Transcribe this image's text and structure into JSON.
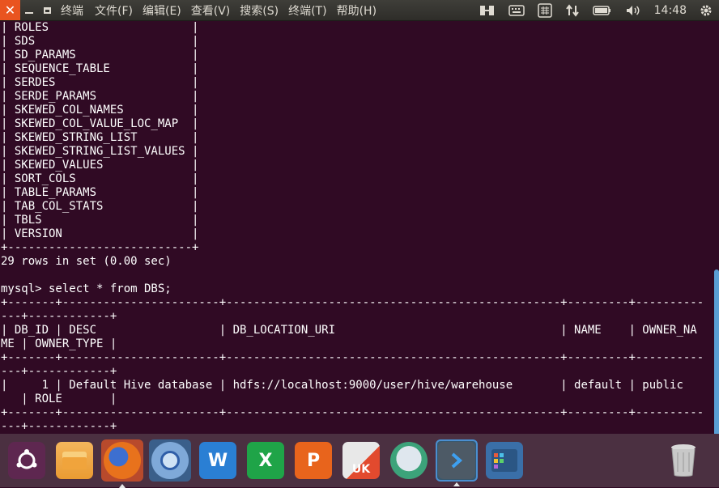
{
  "topbar": {
    "app_title": "终端",
    "menus": [
      "文件(F)",
      "编辑(E)",
      "查看(V)",
      "搜索(S)",
      "终端(T)",
      "帮助(H)"
    ],
    "clock": "14:48",
    "icons": [
      "close-icon",
      "minimize-icon",
      "maximize-icon",
      "transfer-icon",
      "keyboard-icon",
      "input-method-icon",
      "network-icon",
      "battery-icon",
      "volume-icon",
      "gear-icon"
    ],
    "accent_color": "#e95420"
  },
  "terminal": {
    "background": "#300a24",
    "text": "| ROLES                     |\n| SDS                       |\n| SD_PARAMS                 |\n| SEQUENCE_TABLE            |\n| SERDES                    |\n| SERDE_PARAMS              |\n| SKEWED_COL_NAMES          |\n| SKEWED_COL_VALUE_LOC_MAP  |\n| SKEWED_STRING_LIST        |\n| SKEWED_STRING_LIST_VALUES |\n| SKEWED_VALUES             |\n| SORT_COLS                 |\n| TABLE_PARAMS              |\n| TAB_COL_STATS             |\n| TBLS                      |\n| VERSION                   |\n+---------------------------+\n29 rows in set (0.00 sec)\n\nmysql> select * from DBS;\n+-------+-----------------------+-------------------------------------------------+---------+----------\n---+------------+\n| DB_ID | DESC                  | DB_LOCATION_URI                                 | NAME    | OWNER_NA\nME | OWNER_TYPE |\n+-------+-----------------------+-------------------------------------------------+---------+----------\n---+------------+\n|     1 | Default Hive database | hdfs://localhost:9000/user/hive/warehouse       | default | public\n   | ROLE       |\n+-------+-----------------------+-------------------------------------------------+---------+----------\n---+------------+"
  },
  "dock": {
    "items": [
      {
        "name": "ubuntu-dash-icon"
      },
      {
        "name": "files-icon"
      },
      {
        "name": "firefox-icon"
      },
      {
        "name": "chromium-icon"
      },
      {
        "name": "wps-writer-icon",
        "label": "W"
      },
      {
        "name": "wps-spreadsheets-icon",
        "label": "X"
      },
      {
        "name": "wps-presentation-icon",
        "label": "P"
      },
      {
        "name": "ubuntu-store-icon",
        "label": "UK"
      },
      {
        "name": "software-updater-icon"
      },
      {
        "name": "terminal-icon"
      },
      {
        "name": "workspaces-icon"
      },
      {
        "name": "trash-icon"
      }
    ]
  }
}
